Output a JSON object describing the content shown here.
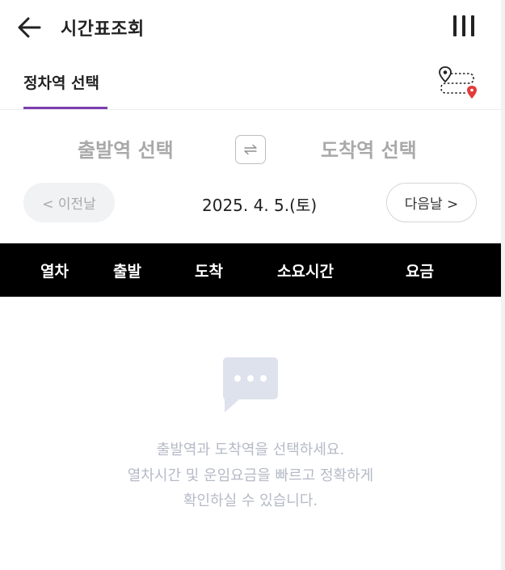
{
  "header": {
    "title": "시간표조회",
    "back_icon": "arrow-left-icon",
    "menu_icon": "bars-icon"
  },
  "tabs": {
    "active_label": "정차역 선택",
    "accent_color": "#7b3fb0",
    "route_icon": "route-map-icon"
  },
  "stations": {
    "departure": "출발역 선택",
    "arrival": "도착역 선택",
    "swap_icon": "swap-icon"
  },
  "date_nav": {
    "prev_label": "< 이전날",
    "date": "2025. 4. 5.(토)",
    "next_label": "다음날 >"
  },
  "table": {
    "headers": [
      "열차",
      "출발",
      "도착",
      "소요시간",
      "요금"
    ]
  },
  "empty_state": {
    "icon": "chat-bubble-icon",
    "lines": [
      "출발역과 도착역을 선택하세요.",
      "열차시간 및 운임요금을 빠르고 정확하게",
      "확인하실 수 있습니다."
    ]
  }
}
